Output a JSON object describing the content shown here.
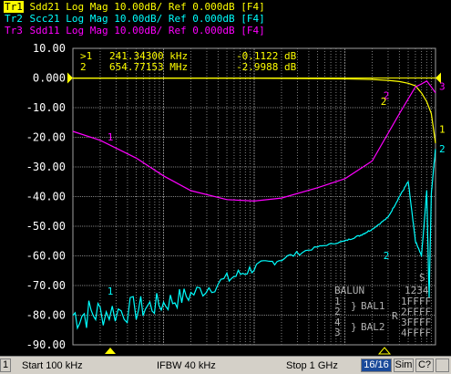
{
  "traces": [
    {
      "tag": "Tr1",
      "text": " Sdd21 Log Mag 10.00dB/ Ref 0.000dB [F4]",
      "color": "#ffff00"
    },
    {
      "tag": "Tr2",
      "text": " Scc21 Log Mag 10.00dB/ Ref 0.000dB [F4]",
      "color": "#00ffff"
    },
    {
      "tag": "Tr3",
      "text": " Sdd11 Log Mag 10.00dB/ Ref 0.000dB [F4]",
      "color": "#ff00ff"
    }
  ],
  "yticks": [
    "10.00",
    "0.000",
    "-10.00",
    "-20.00",
    "-30.00",
    "-40.00",
    "-50.00",
    "-60.00",
    "-70.00",
    "-80.00",
    "-90.00"
  ],
  "markers_readout": [
    {
      "id": ">1",
      "freq": "241.34300 kHz",
      "value": "-0.1122 dB"
    },
    {
      "id": " 2",
      "freq": "654.77153 MHz",
      "value": "-2.9988 dB"
    }
  ],
  "trace_end_labels": [
    "1",
    "2",
    "3"
  ],
  "marker_labels": [
    "1",
    "1",
    "2",
    "2",
    "2"
  ],
  "balun_panel": {
    "title": "BALUN",
    "ports": "1234",
    "rows": [
      "1FFFF",
      "2FFFF",
      "3FFFF",
      "4FFFF"
    ],
    "bal1_ports": [
      "1",
      "2"
    ],
    "bal1": "BAL1",
    "bal2_ports": [
      "4",
      "3"
    ],
    "bal2": "BAL2",
    "s_label": "S",
    "r_label": "R"
  },
  "statusbar": {
    "channel": "1",
    "start": "Start 100 kHz",
    "ifbw": "IFBW 40 kHz",
    "stop": "Stop 1 GHz",
    "sweeps": "16/16",
    "sim": "Sim",
    "cal": "C?",
    "misc": ""
  },
  "colors": {
    "tr1": "#ffff00",
    "tr2": "#00ffff",
    "tr3": "#ff00ff",
    "grid": "#808080",
    "background": "#000000"
  },
  "chart_data": {
    "type": "line",
    "xscale": "log",
    "xlim_hz": [
      100000,
      1000000000
    ],
    "ylim": [
      -90,
      10
    ],
    "ylabel": "",
    "xlabel": "",
    "grid": true,
    "series": [
      {
        "name": "Sdd21",
        "color": "#ffff00",
        "x_hz": [
          100000,
          1000000,
          10000000,
          50000000,
          100000000,
          200000000,
          300000000,
          400000000,
          500000000,
          600000000,
          700000000,
          800000000,
          900000000,
          1000000000
        ],
        "y": [
          -0.1,
          -0.1,
          -0.1,
          -0.2,
          -0.3,
          -0.5,
          -0.8,
          -1.2,
          -1.8,
          -2.6,
          -5,
          -8,
          -12,
          -22
        ]
      },
      {
        "name": "Scc21",
        "color": "#00ffff",
        "x_hz": [
          100000,
          200000,
          500000,
          1000000,
          2000000,
          5000000,
          10000000,
          20000000,
          50000000,
          100000000,
          150000000,
          200000000,
          300000000,
          400000000,
          500000000,
          600000000,
          700000000,
          750000000,
          800000000,
          850000000,
          900000000,
          950000000,
          1000000000
        ],
        "y": [
          -80,
          -79,
          -78,
          -76,
          -73,
          -68,
          -64,
          -61,
          -57,
          -55,
          -53,
          -51,
          -47,
          -40,
          -35,
          -55,
          -60,
          -49,
          -38,
          -74,
          -39,
          -31,
          -24
        ]
      },
      {
        "name": "Sdd11",
        "color": "#ff00ff",
        "x_hz": [
          100000,
          200000,
          500000,
          1000000,
          2000000,
          5000000,
          10000000,
          20000000,
          50000000,
          100000000,
          200000000,
          400000000,
          600000000,
          700000000,
          800000000,
          900000000,
          1000000000
        ],
        "y": [
          -18,
          -21,
          -27,
          -33,
          -38,
          -41,
          -41.5,
          -40.5,
          -37,
          -34,
          -28,
          -12,
          -3,
          -2,
          -1,
          -3,
          -5
        ]
      }
    ]
  }
}
